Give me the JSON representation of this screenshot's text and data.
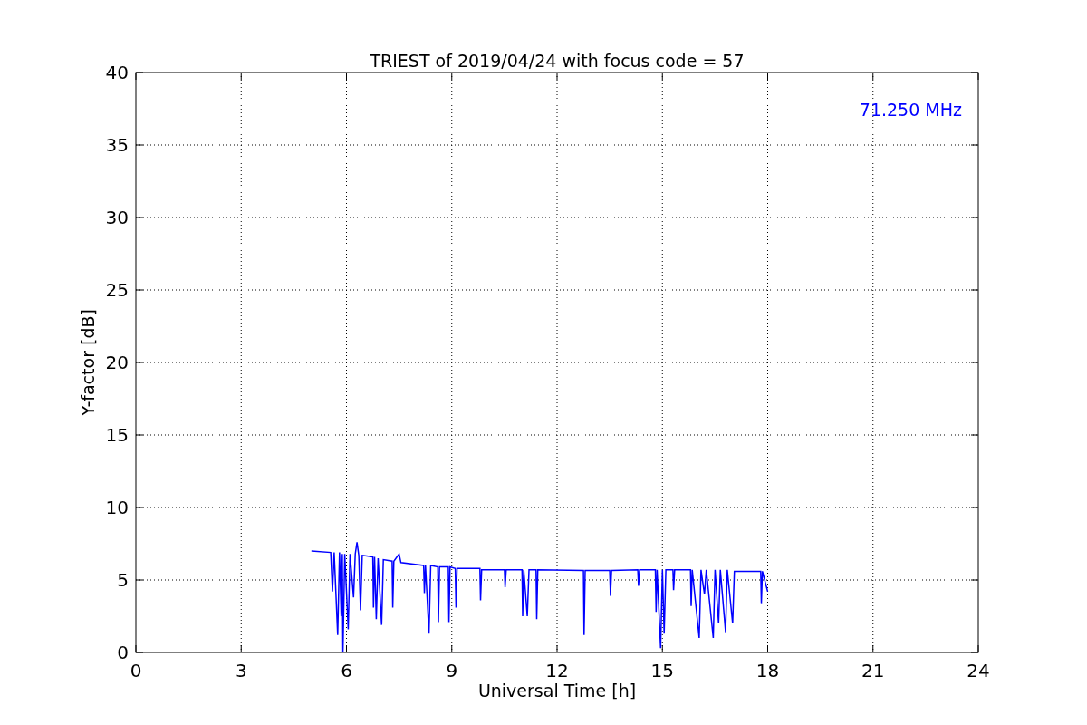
{
  "chart_data": {
    "type": "line",
    "title": "TRIEST of 2019/04/24 with focus code = 57",
    "xlabel": "Universal Time [h]",
    "ylabel": "Y-factor [dB]",
    "x": [
      5.0,
      5.55,
      5.6,
      5.65,
      5.75,
      5.8,
      5.85,
      5.88,
      5.9,
      5.95,
      6.05,
      6.1,
      6.2,
      6.25,
      6.3,
      6.35,
      6.4,
      6.45,
      6.75,
      6.77,
      6.8,
      6.85,
      6.9,
      7.0,
      7.05,
      7.3,
      7.32,
      7.35,
      7.5,
      7.55,
      8.2,
      8.22,
      8.25,
      8.35,
      8.4,
      8.6,
      8.62,
      8.65,
      8.9,
      8.92,
      8.95,
      9.1,
      9.12,
      9.15,
      9.8,
      9.82,
      9.85,
      10.5,
      10.52,
      10.55,
      11.0,
      11.02,
      11.05,
      11.15,
      11.2,
      11.4,
      11.42,
      11.45,
      12.75,
      12.77,
      12.8,
      13.5,
      13.52,
      13.55,
      14.3,
      14.32,
      14.35,
      14.8,
      14.82,
      14.85,
      14.95,
      15.0,
      15.05,
      15.1,
      15.3,
      15.32,
      15.35,
      15.8,
      15.82,
      15.85,
      16.05,
      16.1,
      16.2,
      16.25,
      16.45,
      16.5,
      16.6,
      16.65,
      16.8,
      16.85,
      17.0,
      17.05,
      17.8,
      17.82,
      17.85,
      18.0
    ],
    "series": [
      {
        "name": "71.250 MHz",
        "color": "#0000ff",
        "values": [
          7.0,
          6.9,
          4.2,
          6.9,
          1.2,
          6.9,
          2.5,
          6.8,
          0,
          6.8,
          1.6,
          6.8,
          3.8,
          6.8,
          7.6,
          6.7,
          2.9,
          6.7,
          6.6,
          3.1,
          6.6,
          2.3,
          6.5,
          1.9,
          6.4,
          6.3,
          3.1,
          6.3,
          6.8,
          6.2,
          6.0,
          4.1,
          6.0,
          1.3,
          6.0,
          5.9,
          2.1,
          5.9,
          5.9,
          2.1,
          5.9,
          5.8,
          3.1,
          5.8,
          5.8,
          3.6,
          5.7,
          5.7,
          4.5,
          5.7,
          5.7,
          2.5,
          5.7,
          2.5,
          5.7,
          5.7,
          2.3,
          5.7,
          5.65,
          1.2,
          5.65,
          5.65,
          3.9,
          5.65,
          5.7,
          4.6,
          5.7,
          5.7,
          2.8,
          5.7,
          0.3,
          5.7,
          1.3,
          5.7,
          5.7,
          4.3,
          5.7,
          5.7,
          3.2,
          5.7,
          1.0,
          5.7,
          4.0,
          5.7,
          1.0,
          5.7,
          2.0,
          5.7,
          1.4,
          5.7,
          2.0,
          5.6,
          5.6,
          3.4,
          5.6,
          4.2
        ]
      }
    ],
    "grid": true,
    "xlim": [
      0,
      24
    ],
    "ylim": [
      0,
      40
    ],
    "xticks": [
      0,
      3,
      6,
      9,
      12,
      15,
      18,
      21,
      24
    ],
    "yticks": [
      0,
      5,
      10,
      15,
      20,
      25,
      30,
      35,
      40
    ]
  }
}
